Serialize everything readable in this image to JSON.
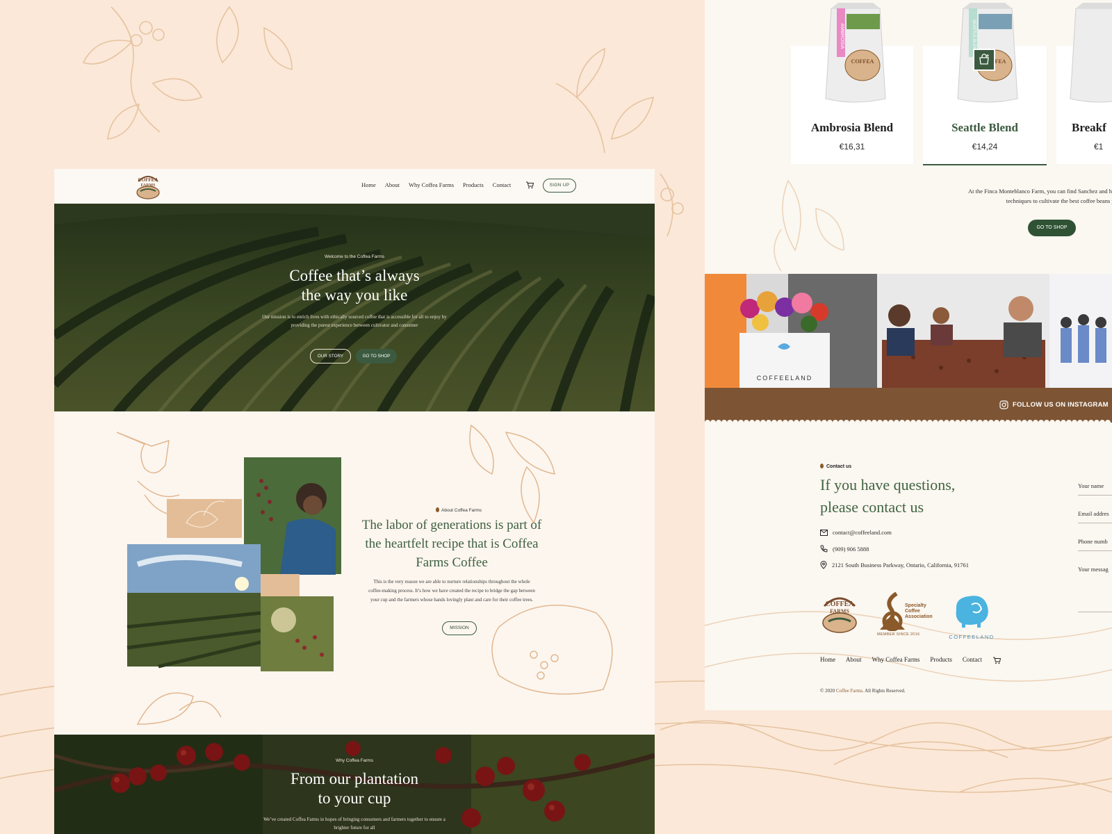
{
  "left_page": {
    "nav": {
      "items": [
        "Home",
        "About",
        "Why Coffea Farms",
        "Products",
        "Contact"
      ],
      "signup_label": "SIGN UP"
    },
    "hero": {
      "kicker": "Welcome to the Coffea Farms",
      "title_line1": "Coffee that’s always",
      "title_line2": "the way you like",
      "text": "Our mission is to enrich lives with ethically sourced coffee that is accessible for all to enjoy by providing the purest experience between cultivator and consumer",
      "btn_story": "OUR STORY",
      "btn_shop": "GO TO SHOP"
    },
    "about": {
      "kicker": "About Coffea Farms",
      "title": "The labor of generations is part of the heartfelt recipe that is Coffea Farms Coffee",
      "text": "This is the very reason we are able to nurture relationships throughout the whole coffee-making process. It’s how we have created the recipe to bridge the gap between your cup and the farmers whose hands lovingly plant and care for their coffee trees.",
      "btn_mission": "MISSION"
    },
    "why": {
      "kicker": "Why Coffea Farms",
      "title_line1": "From our plantation",
      "title_line2": "to your cup",
      "text": "We’ve created Coffea Farms in hopes of bringing consumers and farmers together to ensure a brighter future for all"
    }
  },
  "right_page": {
    "products": [
      {
        "name": "Ambrosia Blend",
        "price": "€16,31",
        "bag_label": "AMBROSIA",
        "bag_color": "#e889c4"
      },
      {
        "name": "Seattle Blend",
        "price": "€14,24",
        "bag_label": "SEATTLE BLEND",
        "bag_color": "#b7dcd0"
      },
      {
        "name": "Breakf",
        "price": "€1",
        "bag_label": "",
        "bag_color": "#d8d8d8"
      }
    ],
    "farm_text_line1": "At the Finca Monteblanco Farm, you can find Sanchez and his te",
    "farm_text_line2": "techniques to cultivate the best coffee beans year",
    "btn_shop": "GO TO SHOP",
    "instagram": {
      "label": "FOLLOW US ON INSTAGRAM",
      "photo_text": "COFFEELAND"
    },
    "contact": {
      "kicker": "Contact us",
      "title_line1": "If you have questions,",
      "title_line2": "please contact us",
      "email": "contact@coffeeland.com",
      "phone": "(909) 906 5888",
      "address": "2121 South Business Parkway, Ontario, California, 91761"
    },
    "form": {
      "name": "Your name",
      "email": "Email addres",
      "phone": "Phone numb",
      "message": "Your messag"
    },
    "logos": {
      "sca_line1": "Specialty",
      "sca_line2": "Coffee",
      "sca_line3": "Association",
      "sca_member": "MEMBER SINCE 2016",
      "coffeeland": "COFFEELAND"
    },
    "footer": {
      "items": [
        "Home",
        "About",
        "Why Coffea Farms",
        "Products",
        "Contact"
      ],
      "copyright_prefix": "© 2020 ",
      "copyright_brand": "Coffee Farms",
      "copyright_suffix": ". All Rights Reserved."
    }
  },
  "colors": {
    "background": "#fbe8d8",
    "green_accent": "#3b5a3f",
    "brown_bar": "#7d5534",
    "illustration": "#e2b78f"
  }
}
